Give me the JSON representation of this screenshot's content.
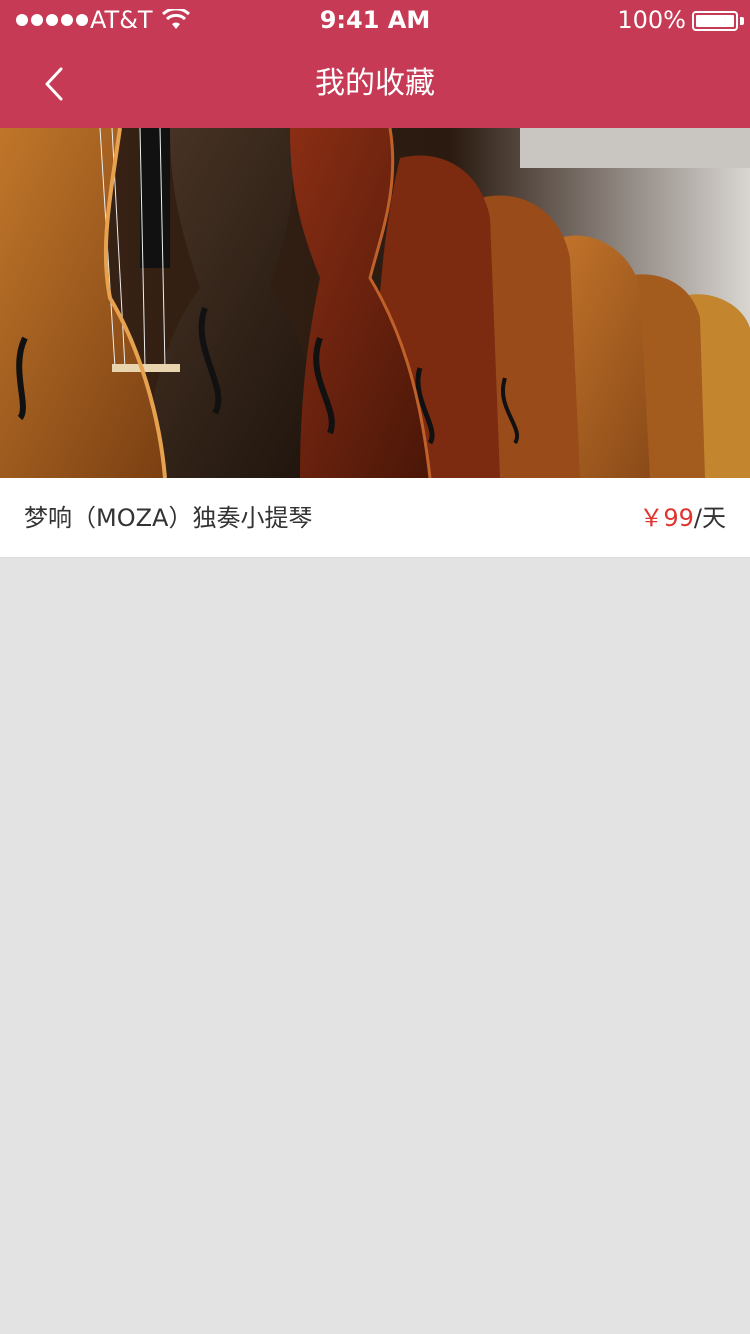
{
  "status_bar": {
    "carrier": "AT&T",
    "time": "9:41 AM",
    "battery": "100%"
  },
  "nav": {
    "title": "我的收藏"
  },
  "favorites": [
    {
      "name": "梦响（MOZA）独奏小提琴",
      "price": "￥99",
      "unit": "/天"
    }
  ],
  "colors": {
    "header": "#c73a55",
    "price": "#e0342f",
    "background": "#e3e3e3"
  }
}
